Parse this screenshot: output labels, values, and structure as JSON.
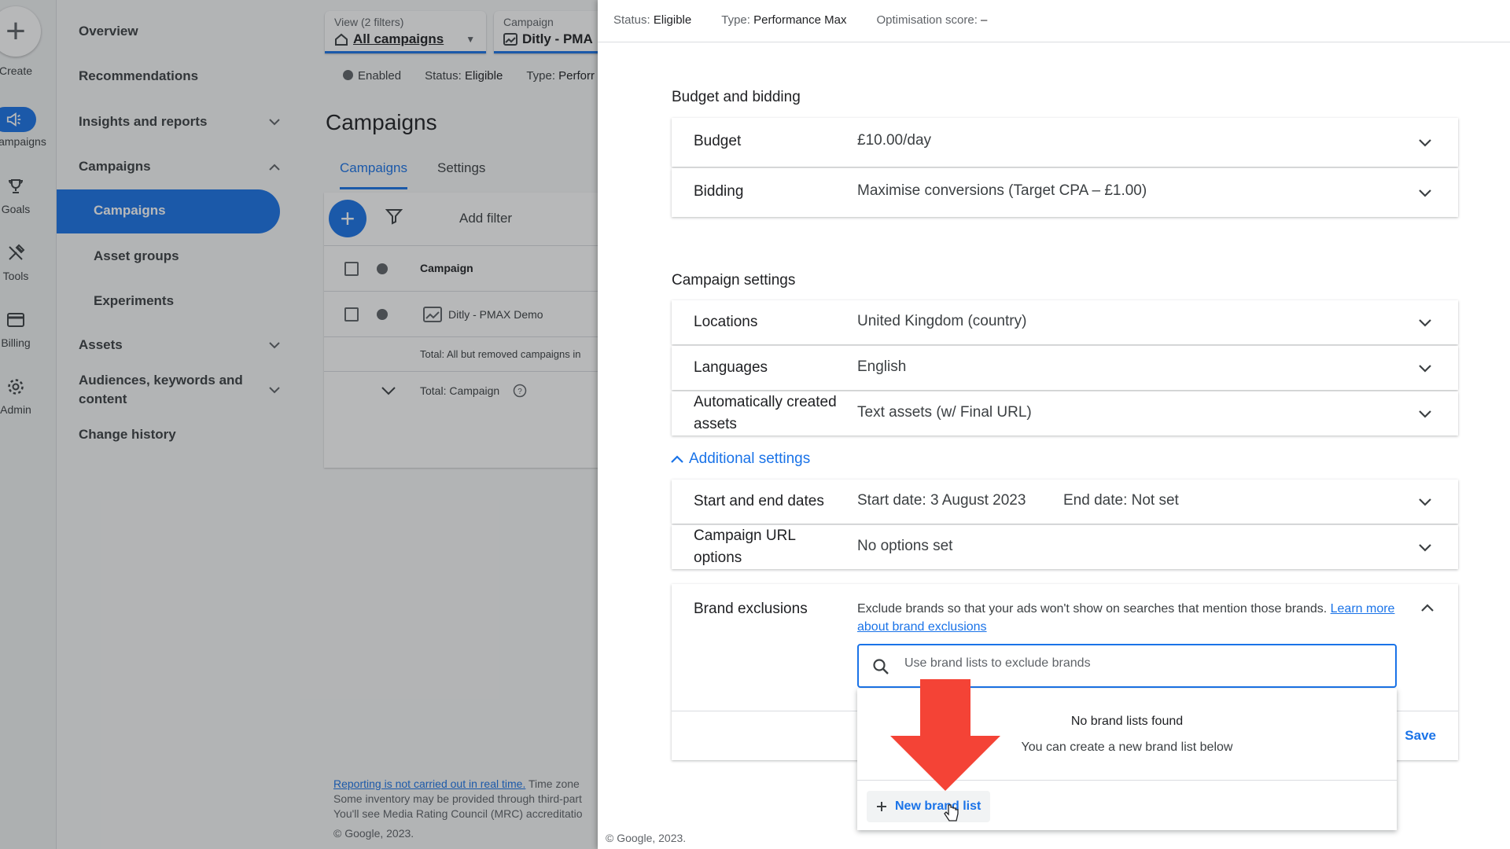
{
  "rail": {
    "create_label": "Create",
    "items": [
      {
        "label": "Campaigns",
        "icon": "megaphone-icon"
      },
      {
        "label": "Goals",
        "icon": "trophy-icon"
      },
      {
        "label": "Tools",
        "icon": "tools-icon"
      },
      {
        "label": "Billing",
        "icon": "credit-card-icon"
      },
      {
        "label": "Admin",
        "icon": "gear-icon"
      }
    ]
  },
  "sidenav": {
    "overview": "Overview",
    "recommendations": "Recommendations",
    "insights": "Insights and reports",
    "campaigns_group": "Campaigns",
    "campaigns_active": "Campaigns",
    "asset_groups": "Asset groups",
    "experiments": "Experiments",
    "assets": "Assets",
    "audiences": "Audiences, keywords and content",
    "change_history": "Change history"
  },
  "main": {
    "view_title": "View (2 filters)",
    "view_value": "All campaigns",
    "campaign_title": "Campaign",
    "campaign_value": "Ditly - PMA",
    "status_enabled": "Enabled",
    "status_label": "Status:",
    "status_value": "Eligible",
    "type_label": "Type:",
    "type_value": "Perforr",
    "page_title": "Campaigns",
    "tabs": [
      "Campaigns",
      "Settings"
    ],
    "add_filter": "Add filter",
    "col_campaign": "Campaign",
    "row_campaign": "Ditly - PMAX Demo",
    "total_all": "Total: All but removed campaigns in",
    "total_campaign": "Total: Campaign",
    "footer_link": "Reporting is not carried out in real time.",
    "footer_tail": " Time zone",
    "footer_line2": "Some inventory may be provided through third-part",
    "footer_line3": "You'll see Media Rating Council (MRC) accreditatio",
    "copyright": "© Google, 2023."
  },
  "panel": {
    "header": {
      "status_label": "Status:",
      "status_value": "Eligible",
      "type_label": "Type:",
      "type_value": "Performance Max",
      "opt_label": "Optimisation score:",
      "opt_value": "–"
    },
    "budget_section": "Budget and bidding",
    "budget_label": "Budget",
    "budget_value": "£10.00/day",
    "bidding_label": "Bidding",
    "bidding_value": "Maximise conversions (Target CPA – £1.00)",
    "campaign_section": "Campaign settings",
    "locations_label": "Locations",
    "locations_value": "United Kingdom (country)",
    "languages_label": "Languages",
    "languages_value": "English",
    "auto_assets_label": "Automatically created assets",
    "auto_assets_value": "Text assets (w/ Final URL)",
    "additional_settings": "Additional settings",
    "dates_label": "Start and end dates",
    "start_date": "Start date: 3 August 2023",
    "end_date": "End date: Not set",
    "url_options_label": "Campaign URL options",
    "url_options_value": "No options set",
    "brand": {
      "label": "Brand exclusions",
      "description": "Exclude brands so that your ads won't show on searches that mention those brands. ",
      "learn_more": "Learn more about brand exclusions",
      "search_placeholder": "Use brand lists to exclude brands",
      "no_lists": "No brand lists found",
      "create_hint": "You can create a new brand list below",
      "new_list": "New brand list",
      "save": "Save"
    },
    "copyright": "© Google, 2023."
  },
  "colors": {
    "accent": "#1a73e8",
    "annotation_arrow": "#f44336"
  }
}
